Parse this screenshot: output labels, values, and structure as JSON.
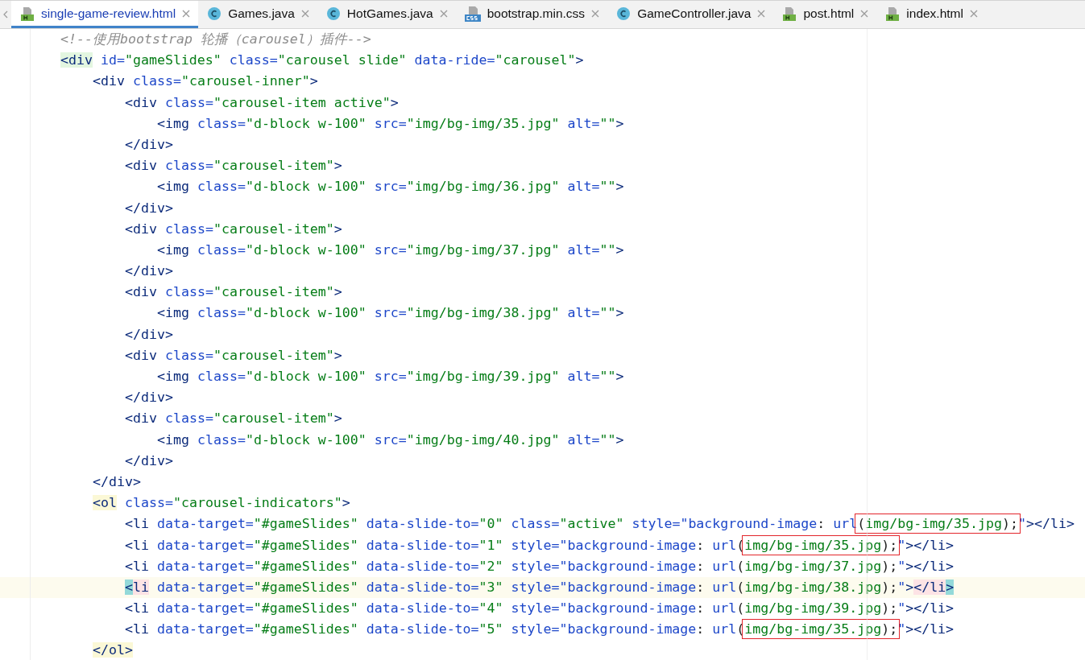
{
  "tabs": [
    {
      "label": "single-game-review.html",
      "kind": "html",
      "selected": true
    },
    {
      "label": "Games.java",
      "kind": "java",
      "selected": false
    },
    {
      "label": "HotGames.java",
      "kind": "java",
      "selected": false
    },
    {
      "label": "bootstrap.min.css",
      "kind": "css",
      "selected": false
    },
    {
      "label": "GameController.java",
      "kind": "java",
      "selected": false
    },
    {
      "label": "post.html",
      "kind": "html",
      "selected": false
    },
    {
      "label": "index.html",
      "kind": "html",
      "selected": false
    }
  ],
  "editor": {
    "lines": [
      {
        "current": false,
        "tokens": [
          {
            "kind": "comment",
            "text": "<!--使用bootstrap 轮播（carousel）插件-->"
          }
        ]
      },
      {
        "current": false,
        "tokens": [
          {
            "kind": "tag",
            "text": "<div",
            "scope_match": true
          },
          {
            "kind": "attr",
            "text": " id="
          },
          {
            "kind": "value",
            "text": "\"gameSlides\""
          },
          {
            "kind": "attr",
            "text": " class="
          },
          {
            "kind": "value",
            "text": "\"carousel slide\""
          },
          {
            "kind": "attr",
            "text": " data-ride="
          },
          {
            "kind": "value",
            "text": "\"carousel\""
          },
          {
            "kind": "tag",
            "text": ">"
          }
        ],
        "children": [
          {
            "current": false,
            "tokens": [
              {
                "kind": "tag",
                "text": "<div"
              },
              {
                "kind": "attr",
                "text": " class="
              },
              {
                "kind": "value",
                "text": "\"carousel-inner\""
              },
              {
                "kind": "tag",
                "text": ">"
              }
            ],
            "children": [
              {
                "current": false,
                "tokens": [
                  {
                    "kind": "tag",
                    "text": "<div"
                  },
                  {
                    "kind": "attr",
                    "text": " class="
                  },
                  {
                    "kind": "value",
                    "text": "\"carousel-item active\""
                  },
                  {
                    "kind": "tag",
                    "text": ">"
                  }
                ],
                "children": [
                  {
                    "current": false,
                    "tokens": [
                      {
                        "kind": "tag",
                        "text": "<img"
                      },
                      {
                        "kind": "attr",
                        "text": " class="
                      },
                      {
                        "kind": "value",
                        "text": "\"d-block w-100\""
                      },
                      {
                        "kind": "attr",
                        "text": " src="
                      },
                      {
                        "kind": "value",
                        "text": "\"img/bg-img/35.jpg\""
                      },
                      {
                        "kind": "attr",
                        "text": " alt="
                      },
                      {
                        "kind": "value",
                        "text": "\"\""
                      },
                      {
                        "kind": "tag",
                        "text": ">"
                      }
                    ]
                  }
                ]
              },
              {
                "current": false,
                "tokens": [
                  {
                    "kind": "tag",
                    "text": "</div>"
                  }
                ]
              },
              {
                "current": false,
                "tokens": [
                  {
                    "kind": "tag",
                    "text": "<div"
                  },
                  {
                    "kind": "attr",
                    "text": " class="
                  },
                  {
                    "kind": "value",
                    "text": "\"carousel-item\""
                  },
                  {
                    "kind": "tag",
                    "text": ">"
                  }
                ],
                "children": [
                  {
                    "current": false,
                    "tokens": [
                      {
                        "kind": "tag",
                        "text": "<img"
                      },
                      {
                        "kind": "attr",
                        "text": " class="
                      },
                      {
                        "kind": "value",
                        "text": "\"d-block w-100\""
                      },
                      {
                        "kind": "attr",
                        "text": " src="
                      },
                      {
                        "kind": "value",
                        "text": "\"img/bg-img/36.jpg\""
                      },
                      {
                        "kind": "attr",
                        "text": " alt="
                      },
                      {
                        "kind": "value",
                        "text": "\"\""
                      },
                      {
                        "kind": "tag",
                        "text": ">"
                      }
                    ]
                  }
                ]
              },
              {
                "current": false,
                "tokens": [
                  {
                    "kind": "tag",
                    "text": "</div>"
                  }
                ]
              },
              {
                "current": false,
                "tokens": [
                  {
                    "kind": "tag",
                    "text": "<div"
                  },
                  {
                    "kind": "attr",
                    "text": " class="
                  },
                  {
                    "kind": "value",
                    "text": "\"carousel-item\""
                  },
                  {
                    "kind": "tag",
                    "text": ">"
                  }
                ],
                "children": [
                  {
                    "current": false,
                    "tokens": [
                      {
                        "kind": "tag",
                        "text": "<img"
                      },
                      {
                        "kind": "attr",
                        "text": " class="
                      },
                      {
                        "kind": "value",
                        "text": "\"d-block w-100\""
                      },
                      {
                        "kind": "attr",
                        "text": " src="
                      },
                      {
                        "kind": "value",
                        "text": "\"img/bg-img/37.jpg\""
                      },
                      {
                        "kind": "attr",
                        "text": " alt="
                      },
                      {
                        "kind": "value",
                        "text": "\"\""
                      },
                      {
                        "kind": "tag",
                        "text": ">"
                      }
                    ]
                  }
                ]
              },
              {
                "current": false,
                "tokens": [
                  {
                    "kind": "tag",
                    "text": "</div>"
                  }
                ]
              },
              {
                "current": false,
                "tokens": [
                  {
                    "kind": "tag",
                    "text": "<div"
                  },
                  {
                    "kind": "attr",
                    "text": " class="
                  },
                  {
                    "kind": "value",
                    "text": "\"carousel-item\""
                  },
                  {
                    "kind": "tag",
                    "text": ">"
                  }
                ],
                "children": [
                  {
                    "current": false,
                    "tokens": [
                      {
                        "kind": "tag",
                        "text": "<img"
                      },
                      {
                        "kind": "attr",
                        "text": " class="
                      },
                      {
                        "kind": "value",
                        "text": "\"d-block w-100\""
                      },
                      {
                        "kind": "attr",
                        "text": " src="
                      },
                      {
                        "kind": "value",
                        "text": "\"img/bg-img/38.jpg\""
                      },
                      {
                        "kind": "attr",
                        "text": " alt="
                      },
                      {
                        "kind": "value",
                        "text": "\"\""
                      },
                      {
                        "kind": "tag",
                        "text": ">"
                      }
                    ]
                  }
                ]
              },
              {
                "current": false,
                "tokens": [
                  {
                    "kind": "tag",
                    "text": "</div>"
                  }
                ]
              },
              {
                "current": false,
                "tokens": [
                  {
                    "kind": "tag",
                    "text": "<div"
                  },
                  {
                    "kind": "attr",
                    "text": " class="
                  },
                  {
                    "kind": "value",
                    "text": "\"carousel-item\""
                  },
                  {
                    "kind": "tag",
                    "text": ">"
                  }
                ],
                "children": [
                  {
                    "current": false,
                    "tokens": [
                      {
                        "kind": "tag",
                        "text": "<img"
                      },
                      {
                        "kind": "attr",
                        "text": " class="
                      },
                      {
                        "kind": "value",
                        "text": "\"d-block w-100\""
                      },
                      {
                        "kind": "attr",
                        "text": " src="
                      },
                      {
                        "kind": "value",
                        "text": "\"img/bg-img/39.jpg\""
                      },
                      {
                        "kind": "attr",
                        "text": " alt="
                      },
                      {
                        "kind": "value",
                        "text": "\"\""
                      },
                      {
                        "kind": "tag",
                        "text": ">"
                      }
                    ]
                  }
                ]
              },
              {
                "current": false,
                "tokens": [
                  {
                    "kind": "tag",
                    "text": "</div>"
                  }
                ]
              },
              {
                "current": false,
                "tokens": [
                  {
                    "kind": "tag",
                    "text": "<div"
                  },
                  {
                    "kind": "attr",
                    "text": " class="
                  },
                  {
                    "kind": "value",
                    "text": "\"carousel-item\""
                  },
                  {
                    "kind": "tag",
                    "text": ">"
                  }
                ],
                "children": [
                  {
                    "current": false,
                    "tokens": [
                      {
                        "kind": "tag",
                        "text": "<img"
                      },
                      {
                        "kind": "attr",
                        "text": " class="
                      },
                      {
                        "kind": "value",
                        "text": "\"d-block w-100\""
                      },
                      {
                        "kind": "attr",
                        "text": " src="
                      },
                      {
                        "kind": "value",
                        "text": "\"img/bg-img/40.jpg\""
                      },
                      {
                        "kind": "attr",
                        "text": " alt="
                      },
                      {
                        "kind": "value",
                        "text": "\"\""
                      },
                      {
                        "kind": "tag",
                        "text": ">"
                      }
                    ]
                  }
                ]
              },
              {
                "current": false,
                "tokens": [
                  {
                    "kind": "tag",
                    "text": "</div>"
                  }
                ]
              }
            ]
          },
          {
            "current": false,
            "tokens": [
              {
                "kind": "tag",
                "text": "</div>"
              }
            ]
          },
          {
            "current": false,
            "tokens": [
              {
                "kind": "tag",
                "text": "<ol",
                "pair_match": true
              },
              {
                "kind": "attr",
                "text": " class="
              },
              {
                "kind": "value",
                "text": "\"carousel-indicators\""
              },
              {
                "kind": "tag",
                "text": ">"
              }
            ],
            "children": [
              {
                "current": false,
                "tokens": [
                  {
                    "kind": "tag",
                    "text": "<li"
                  },
                  {
                    "kind": "attr",
                    "text": " data-target="
                  },
                  {
                    "kind": "value",
                    "text": "\"#gameSlides\""
                  },
                  {
                    "kind": "attr",
                    "text": " data-slide-to="
                  },
                  {
                    "kind": "value",
                    "text": "\"0\""
                  },
                  {
                    "kind": "attr",
                    "text": " class="
                  },
                  {
                    "kind": "value",
                    "text": "\"active\""
                  },
                  {
                    "kind": "attr",
                    "text": " style=\"background-image"
                  },
                  {
                    "kind": "punct",
                    "text": ": "
                  },
                  {
                    "kind": "attr",
                    "text": "url"
                  },
                  {
                    "kind": "boxed",
                    "parts": [
                      {
                        "kind": "punct",
                        "text": "("
                      },
                      {
                        "kind": "value",
                        "text": "img/bg-img/35.jpg"
                      },
                      {
                        "kind": "punct",
                        "text": ");"
                      }
                    ]
                  },
                  {
                    "kind": "attr",
                    "text": "\""
                  },
                  {
                    "kind": "tag",
                    "text": "></li>"
                  }
                ]
              },
              {
                "current": false,
                "tokens": [
                  {
                    "kind": "tag",
                    "text": "<li"
                  },
                  {
                    "kind": "attr",
                    "text": " data-target="
                  },
                  {
                    "kind": "value",
                    "text": "\"#gameSlides\""
                  },
                  {
                    "kind": "attr",
                    "text": " data-slide-to="
                  },
                  {
                    "kind": "value",
                    "text": "\"1\""
                  },
                  {
                    "kind": "attr",
                    "text": " style=\"background-image"
                  },
                  {
                    "kind": "punct",
                    "text": ": "
                  },
                  {
                    "kind": "attr",
                    "text": "url"
                  },
                  {
                    "kind": "punct",
                    "text": "("
                  },
                  {
                    "kind": "boxed",
                    "parts": [
                      {
                        "kind": "value",
                        "text": "img/bg-img/35.jpg"
                      },
                      {
                        "kind": "punct",
                        "text": ");"
                      }
                    ]
                  },
                  {
                    "kind": "attr",
                    "text": "\""
                  },
                  {
                    "kind": "tag",
                    "text": "></li>"
                  }
                ]
              },
              {
                "current": false,
                "tokens": [
                  {
                    "kind": "tag",
                    "text": "<li"
                  },
                  {
                    "kind": "attr",
                    "text": " data-target="
                  },
                  {
                    "kind": "value",
                    "text": "\"#gameSlides\""
                  },
                  {
                    "kind": "attr",
                    "text": " data-slide-to="
                  },
                  {
                    "kind": "value",
                    "text": "\"2\""
                  },
                  {
                    "kind": "attr",
                    "text": " style=\"background-image"
                  },
                  {
                    "kind": "punct",
                    "text": ": "
                  },
                  {
                    "kind": "attr",
                    "text": "url"
                  },
                  {
                    "kind": "punct",
                    "text": "("
                  },
                  {
                    "kind": "value",
                    "text": "img/bg-img/37.jpg"
                  },
                  {
                    "kind": "punct",
                    "text": ");"
                  },
                  {
                    "kind": "attr",
                    "text": "\""
                  },
                  {
                    "kind": "tag",
                    "text": "></li>"
                  }
                ]
              },
              {
                "current": true,
                "tokens": [
                  {
                    "kind": "tag",
                    "text": "<",
                    "brace_match": true
                  },
                  {
                    "kind": "tag",
                    "text": "li",
                    "tag_match": true
                  },
                  {
                    "kind": "attr",
                    "text": " data-target="
                  },
                  {
                    "kind": "value",
                    "text": "\"#gameSlides\""
                  },
                  {
                    "kind": "attr",
                    "text": " data-slide-to="
                  },
                  {
                    "kind": "value",
                    "text": "\"3\""
                  },
                  {
                    "kind": "attr",
                    "text": " style=\"background-image"
                  },
                  {
                    "kind": "punct",
                    "text": ": "
                  },
                  {
                    "kind": "attr",
                    "text": "url"
                  },
                  {
                    "kind": "punct",
                    "text": "("
                  },
                  {
                    "kind": "value",
                    "text": "img/bg-img/38.jpg"
                  },
                  {
                    "kind": "punct",
                    "text": ");"
                  },
                  {
                    "kind": "attr",
                    "text": "\""
                  },
                  {
                    "kind": "tag",
                    "text": ">"
                  },
                  {
                    "kind": "tag",
                    "text": "</li",
                    "tag_match": true
                  },
                  {
                    "kind": "tag",
                    "text": ">",
                    "brace_match": true
                  }
                ]
              },
              {
                "current": false,
                "tokens": [
                  {
                    "kind": "tag",
                    "text": "<li"
                  },
                  {
                    "kind": "attr",
                    "text": " data-target="
                  },
                  {
                    "kind": "value",
                    "text": "\"#gameSlides\""
                  },
                  {
                    "kind": "attr",
                    "text": " data-slide-to="
                  },
                  {
                    "kind": "value",
                    "text": "\"4\""
                  },
                  {
                    "kind": "attr",
                    "text": " style=\"background-image"
                  },
                  {
                    "kind": "punct",
                    "text": ": "
                  },
                  {
                    "kind": "attr",
                    "text": "url"
                  },
                  {
                    "kind": "punct",
                    "text": "("
                  },
                  {
                    "kind": "value",
                    "text": "img/bg-img/39.jpg"
                  },
                  {
                    "kind": "punct",
                    "text": ");"
                  },
                  {
                    "kind": "attr",
                    "text": "\""
                  },
                  {
                    "kind": "tag",
                    "text": "></li>"
                  }
                ]
              },
              {
                "current": false,
                "tokens": [
                  {
                    "kind": "tag",
                    "text": "<li"
                  },
                  {
                    "kind": "attr",
                    "text": " data-target="
                  },
                  {
                    "kind": "value",
                    "text": "\"#gameSlides\""
                  },
                  {
                    "kind": "attr",
                    "text": " data-slide-to="
                  },
                  {
                    "kind": "value",
                    "text": "\"5\""
                  },
                  {
                    "kind": "attr",
                    "text": " style=\"background-image"
                  },
                  {
                    "kind": "punct",
                    "text": ": "
                  },
                  {
                    "kind": "attr",
                    "text": "url"
                  },
                  {
                    "kind": "punct",
                    "text": "("
                  },
                  {
                    "kind": "boxed",
                    "parts": [
                      {
                        "kind": "value",
                        "text": "img/bg-img/35.jpg"
                      },
                      {
                        "kind": "punct",
                        "text": ");"
                      }
                    ]
                  },
                  {
                    "kind": "attr",
                    "text": "\""
                  },
                  {
                    "kind": "tag",
                    "text": "></li>"
                  }
                ]
              }
            ]
          },
          {
            "current": false,
            "tokens": [
              {
                "kind": "tag",
                "text": "</ol>",
                "pair_match": true
              }
            ]
          }
        ]
      }
    ]
  }
}
